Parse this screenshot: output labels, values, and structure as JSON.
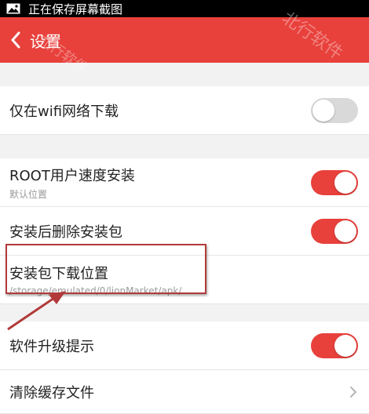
{
  "status_bar": {
    "text": "正在保存屏幕截图"
  },
  "app_bar": {
    "title": "设置"
  },
  "settings": {
    "wifi_only": {
      "label": "仅在wifi网络下载",
      "enabled": false
    },
    "root_install": {
      "label": "ROOT用户速度安装",
      "subtitle": "默认位置",
      "enabled": true
    },
    "delete_after_install": {
      "label": "安装后删除安装包",
      "enabled": true
    },
    "download_location": {
      "label": "安装包下载位置",
      "subtitle": "/storage/emulated/0/lionMarket/apk/"
    },
    "upgrade_prompt": {
      "label": "软件升级提示",
      "enabled": true
    },
    "clear_cache": {
      "label": "清除缓存文件"
    }
  },
  "watermarks": [
    "北行软件",
    "北行软件"
  ],
  "colors": {
    "accent": "#e8413c",
    "toggle_off": "#d9d9d9",
    "annotation": "#b23a3a"
  }
}
